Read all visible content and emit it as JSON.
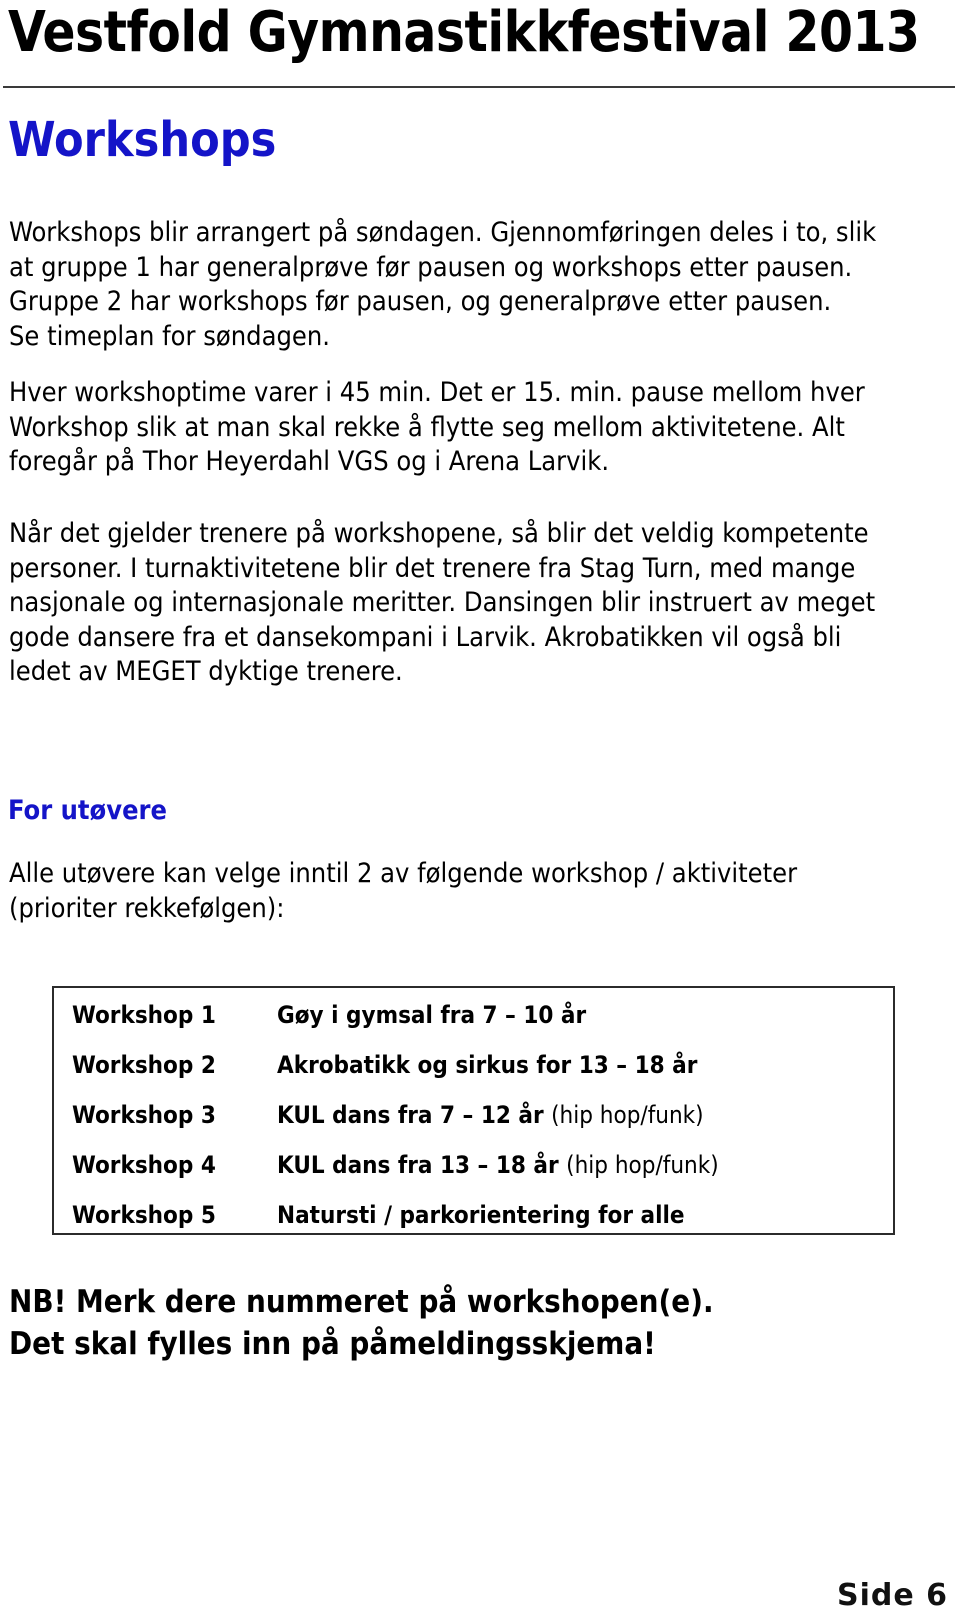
{
  "document": {
    "title": "Vestfold Gymnastikkfestival 2013",
    "accent_color": "#1414c8",
    "text_color": "#000000",
    "rule_color": "#3a3a3a"
  },
  "sections": {
    "workshops_heading": "Workshops",
    "paragraph_1": {
      "lines": [
        "Workshops blir arrangert på søndagen. Gjennomføringen deles i to, slik",
        "at gruppe 1 har generalprøve før pausen og workshops etter pausen.",
        "Gruppe 2 har workshops før pausen, og generalprøve etter pausen.",
        "Se timeplan for søndagen."
      ]
    },
    "paragraph_2": {
      "lines": [
        "Hver workshoptime varer i 45 min. Det er 15. min. pause mellom hver",
        "Workshop slik at man skal rekke å flytte seg mellom aktivitetene. Alt",
        "foregår på Thor Heyerdahl VGS og i Arena Larvik."
      ]
    },
    "paragraph_3": {
      "lines": [
        "Når det gjelder trenere på workshopene, så blir det veldig kompetente",
        "personer. I turnaktivitetene blir det trenere fra Stag Turn, med mange",
        "nasjonale og internasjonale meritter. Dansingen blir instruert av meget",
        "gode dansere fra et dansekompani i Larvik. Akrobatikken vil også bli",
        "ledet av MEGET dyktige trenere."
      ]
    },
    "for_utovere_heading": "For utøvere",
    "paragraph_4": {
      "lines": [
        "Alle utøvere kan velge inntil 2 av følgende workshop / aktiviteter",
        "(prioriter rekkefølgen):"
      ]
    }
  },
  "workshop_table": {
    "rows": [
      {
        "label": "Workshop 1",
        "value": "Gøy i gymsal fra 7 – 10 år",
        "note": ""
      },
      {
        "label": "Workshop 2",
        "value": "Akrobatikk og sirkus for 13 – 18 år",
        "note": ""
      },
      {
        "label": "Workshop 3",
        "value": "KUL dans fra 7 – 12 år ",
        "note": "(hip hop/funk)"
      },
      {
        "label": "Workshop 4",
        "value": "KUL dans fra 13 – 18 år ",
        "note": "(hip hop/funk)"
      },
      {
        "label": "Workshop 5",
        "value": "Natursti / parkorientering for alle",
        "note": ""
      }
    ]
  },
  "notice": {
    "lines": [
      "NB! Merk dere nummeret på workshopen(e).",
      "Det skal fylles inn på påmeldingsskjema!"
    ]
  },
  "footer": {
    "page_label": "Side 6"
  }
}
